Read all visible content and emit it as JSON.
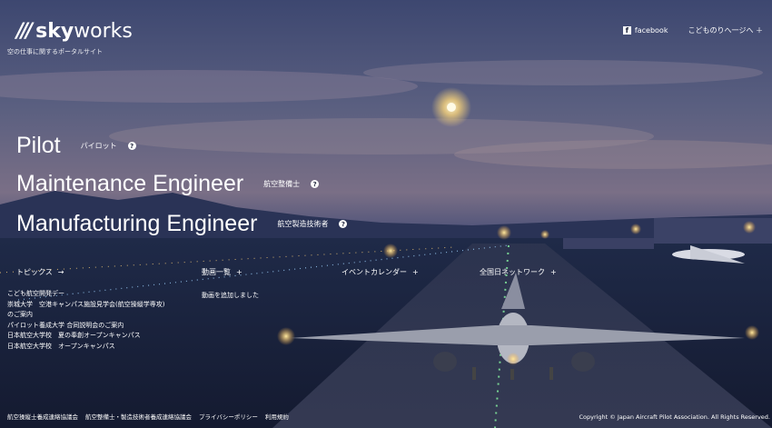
{
  "brand": {
    "mark": "///",
    "name_bold": "sky",
    "name_rest": "works",
    "tagline": "空の仕事に関するポータルサイト"
  },
  "topnav": {
    "facebook": "facebook",
    "kids": "こどものりへ一ジへ ＋"
  },
  "roles": [
    {
      "title": "Pilot",
      "sub": "パイロット"
    },
    {
      "title": "Maintenance Engineer",
      "sub": "航空整備士"
    },
    {
      "title": "Manufacturing Engineer",
      "sub": "航空製造技術者"
    }
  ],
  "sections": {
    "topics": "トピックス",
    "videos": "動画一覧",
    "events": "イベントカレンダー",
    "jobs": "全国日ネットワーク"
  },
  "news": [
    "こども航空開発デー",
    "崇城大学　空港キャンパス施設見学会(航空操縦学専攻)",
    "のご案内",
    "パイロット養成大学 合同説明会のご案内",
    "日本航空大学校　夏の奉創オープンキャンパス",
    "日本航空大学校　オープンキャンパス"
  ],
  "video_added": "動画を追加しました",
  "footer": {
    "links": [
      "航空操縦士養成連絡協議会",
      "航空整備士・製造技術者養成連絡協議会",
      "プライバシーポリシー",
      "利用規約"
    ],
    "copyright": "Copyright © Japan Aircraft Pilot Association. All Rights Reserved."
  }
}
